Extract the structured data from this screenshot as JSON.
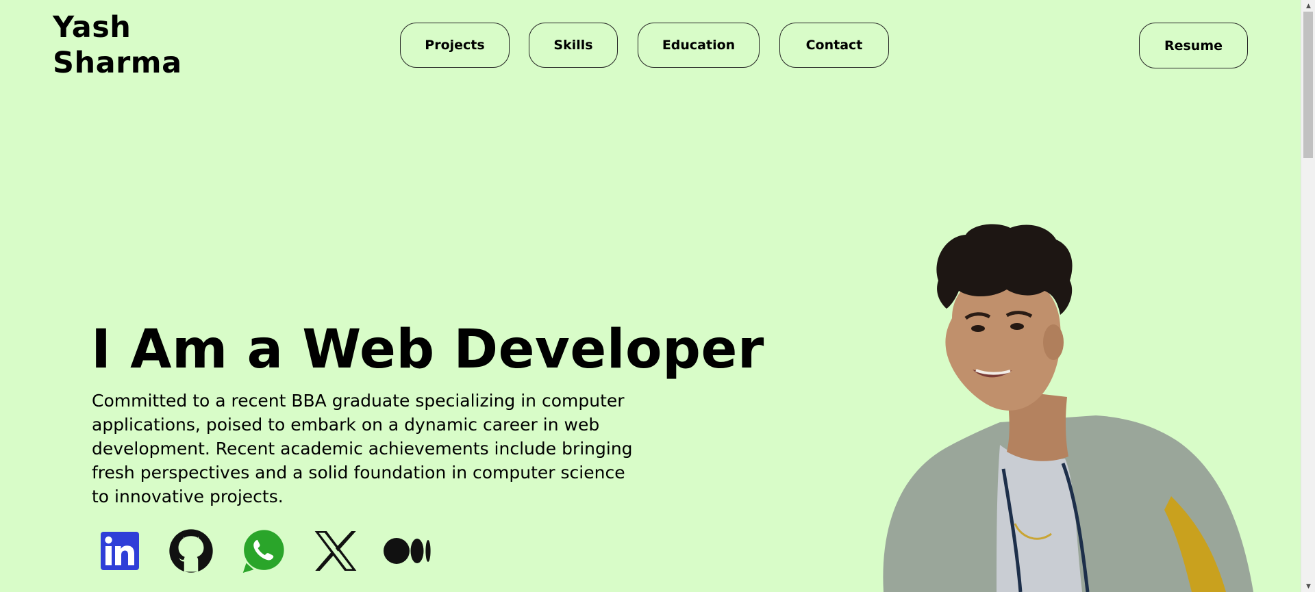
{
  "header": {
    "brand_first": "Yash",
    "brand_last": "Sharma",
    "nav": [
      "Projects",
      "Skills",
      "Education",
      "Contact"
    ],
    "resume_label": "Resume"
  },
  "hero": {
    "title": "I Am a Web Developer",
    "description": "Committed to a recent BBA graduate specializing in computer applications, poised to embark on a dynamic career in web development. Recent academic achievements include bringing fresh perspectives and a solid foundation in computer science to innovative projects."
  },
  "socials": [
    {
      "icon": "linkedin-icon",
      "color": "#2f3ed8"
    },
    {
      "icon": "github-icon",
      "color": "#111111"
    },
    {
      "icon": "whatsapp-icon",
      "color": "#2aa52a"
    },
    {
      "icon": "x-icon",
      "color": "#111111"
    },
    {
      "icon": "medium-icon",
      "color": "#111111"
    }
  ],
  "colors": {
    "background": "#d8fcc8",
    "text": "#000000"
  }
}
